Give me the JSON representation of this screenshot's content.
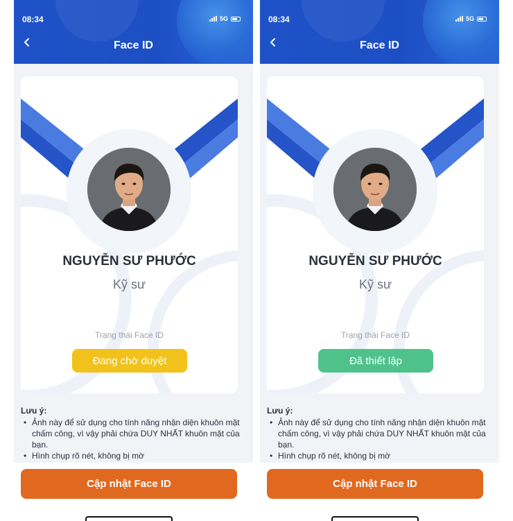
{
  "screens": [
    {
      "status_time": "08:34",
      "network": "5G",
      "title": "Face ID",
      "name": "NGUYỄN SƯ PHƯỚC",
      "role": "Kỹ sư",
      "status_label": "Trạng thái Face ID",
      "status_value": "Đang chờ duyệt",
      "status_color": "#f1c21b",
      "note_title": "Lưu ý:",
      "notes": [
        "Ảnh này để sử dụng cho tính năng nhận diện khuôn mặt chấm công, vì vậy phải chứa DUY NHẤT khuôn mặt của bạn.",
        "Hình chụp rõ nét, không bị mờ"
      ],
      "button_label": "Cập nhật Face ID"
    },
    {
      "status_time": "08:34",
      "network": "5G",
      "title": "Face ID",
      "name": "NGUYỄN SƯ PHƯỚC",
      "role": "Kỹ sư",
      "status_label": "Trạng thái Face ID",
      "status_value": "Đã thiết lập",
      "status_color": "#4fc28b",
      "note_title": "Lưu ý:",
      "notes": [
        "Ảnh này để sử dụng cho tính năng nhận diện khuôn mặt chấm công, vì vậy phải chứa DUY NHẤT khuôn mặt của bạn.",
        "Hình chụp rõ nét, không bị mờ"
      ],
      "button_label": "Cập nhật Face ID"
    }
  ],
  "colors": {
    "header": "#1f52c8",
    "cta": "#e0691f",
    "ribbon_dark": "#2554c8",
    "ribbon_light": "#4a7be0"
  },
  "icons": {
    "back": "chevron-left-icon",
    "signal": "signal-bars-icon",
    "battery": "battery-icon"
  }
}
